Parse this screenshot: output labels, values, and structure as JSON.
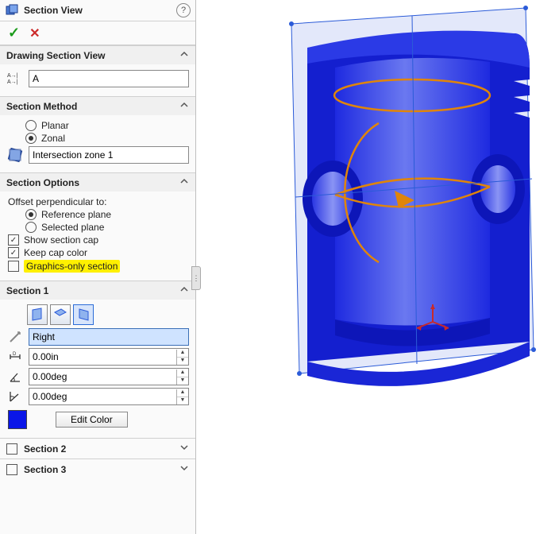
{
  "title": "Section View",
  "drawing_section_view": {
    "header": "Drawing Section View",
    "value": "A"
  },
  "section_method": {
    "header": "Section Method",
    "planar": "Planar",
    "zonal": "Zonal",
    "selected": "zonal",
    "zone_value": "Intersection zone 1"
  },
  "section_options": {
    "header": "Section Options",
    "offset_label": "Offset perpendicular to:",
    "reference_plane": "Reference plane",
    "selected_plane": "Selected plane",
    "offset_selected": "reference",
    "show_cap": "Show section cap",
    "keep_color": "Keep cap color",
    "graphics_only": "Graphics-only section",
    "show_cap_checked": true,
    "keep_color_checked": true,
    "graphics_only_checked": false
  },
  "section1": {
    "header": "Section 1",
    "plane_value": "Right",
    "distance": "0.00in",
    "angle1": "0.00deg",
    "angle2": "0.00deg",
    "edit_color": "Edit Color",
    "color": "#0a16e8"
  },
  "section2": {
    "header": "Section 2"
  },
  "section3": {
    "header": "Section 3"
  }
}
